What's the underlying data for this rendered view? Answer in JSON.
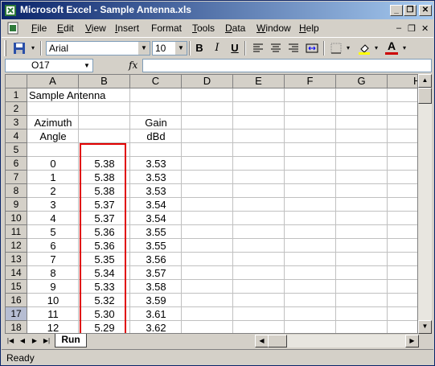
{
  "window": {
    "title": "Microsoft Excel - Sample Antenna.xls",
    "controls": {
      "minimize": "_",
      "restore": "❐",
      "close": "✕"
    }
  },
  "menubar": {
    "items": [
      {
        "key": "F",
        "rest": "ile"
      },
      {
        "key": "E",
        "rest": "dit"
      },
      {
        "key": "V",
        "rest": "iew"
      },
      {
        "key": "I",
        "rest": "nsert"
      },
      {
        "key": "",
        "rest": "Format"
      },
      {
        "key": "T",
        "rest": "ools"
      },
      {
        "key": "D",
        "rest": "ata"
      },
      {
        "key": "W",
        "rest": "indow"
      },
      {
        "key": "H",
        "rest": "elp"
      }
    ],
    "doc_controls": {
      "minimize": "–",
      "restore": "❐",
      "close": "✕"
    }
  },
  "toolbar": {
    "font_name": "Arial",
    "font_size": "10",
    "bold": "B",
    "italic": "I",
    "underline": "U",
    "font_color_glyph": "A",
    "accent_red": "#cc0000",
    "fill_yellow": "#ffff00"
  },
  "formula_bar": {
    "name_box": "O17",
    "fx_label": "fx",
    "formula": ""
  },
  "sheet": {
    "columns": [
      "A",
      "B",
      "C",
      "D",
      "E",
      "F",
      "G",
      "H"
    ],
    "rows": [
      "1",
      "2",
      "3",
      "4",
      "5",
      "6",
      "7",
      "8",
      "9",
      "10",
      "11",
      "12",
      "13",
      "14",
      "15",
      "16",
      "17",
      "18"
    ],
    "selected_row": "17",
    "title_cell": "Sample Antenna",
    "header_row3": {
      "A": "Azimuth",
      "C": "Gain"
    },
    "header_row4": {
      "A": "Angle",
      "C": "dBd"
    },
    "data": [
      {
        "a": "0",
        "b": "5.38",
        "c": "3.53"
      },
      {
        "a": "1",
        "b": "5.38",
        "c": "3.53"
      },
      {
        "a": "2",
        "b": "5.38",
        "c": "3.53"
      },
      {
        "a": "3",
        "b": "5.37",
        "c": "3.54"
      },
      {
        "a": "4",
        "b": "5.37",
        "c": "3.54"
      },
      {
        "a": "5",
        "b": "5.36",
        "c": "3.55"
      },
      {
        "a": "6",
        "b": "5.36",
        "c": "3.55"
      },
      {
        "a": "7",
        "b": "5.35",
        "c": "3.56"
      },
      {
        "a": "8",
        "b": "5.34",
        "c": "3.57"
      },
      {
        "a": "9",
        "b": "5.33",
        "c": "3.58"
      },
      {
        "a": "10",
        "b": "5.32",
        "c": "3.59"
      },
      {
        "a": "11",
        "b": "5.30",
        "c": "3.61"
      },
      {
        "a": "12",
        "b": "5.29",
        "c": "3.62"
      }
    ],
    "highlight_color": "#e00000"
  },
  "tabs": {
    "active_sheet": "Run",
    "nav": [
      "|◀",
      "◀",
      "▶",
      "▶|"
    ]
  },
  "status": {
    "text": "Ready"
  }
}
